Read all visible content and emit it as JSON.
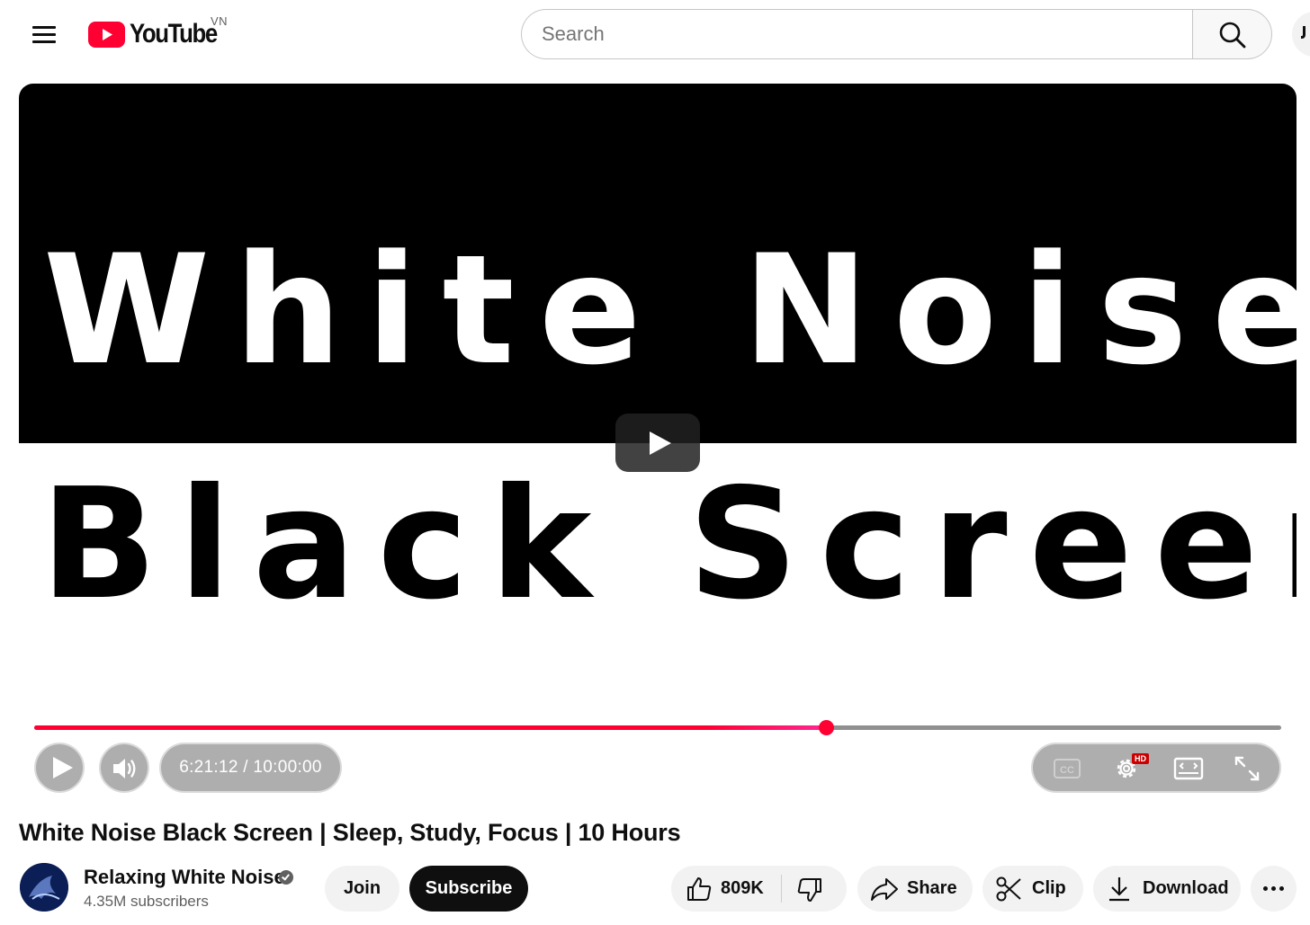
{
  "masthead": {
    "logo_text": "YouTube",
    "country_code": "VN",
    "search_placeholder": "Search"
  },
  "player": {
    "thumbnail_line1": "White Noise",
    "thumbnail_line2": "Black Screen",
    "time_display": "6:21:12 / 10:00:00",
    "progress_fraction": 0.635,
    "cc_label": "CC",
    "quality_badge": "HD",
    "progress_color": "#ff0033"
  },
  "video": {
    "title": "White Noise Black Screen | Sleep, Study, Focus | 10 Hours"
  },
  "channel": {
    "name": "Relaxing White Noise",
    "subscribers": "4.35M subscribers",
    "join_label": "Join",
    "subscribe_label": "Subscribe"
  },
  "actions": {
    "like_count": "809K",
    "share_label": "Share",
    "clip_label": "Clip",
    "download_label": "Download"
  },
  "icons": [
    "menu-icon",
    "youtube-logo-icon",
    "search-icon",
    "microphone-icon",
    "play-icon",
    "volume-icon",
    "closed-captions-icon",
    "settings-icon",
    "theater-mode-icon",
    "fullscreen-icon",
    "verified-icon",
    "thumbs-up-icon",
    "thumbs-down-icon",
    "share-icon",
    "scissors-icon",
    "download-icon",
    "more-icon"
  ]
}
